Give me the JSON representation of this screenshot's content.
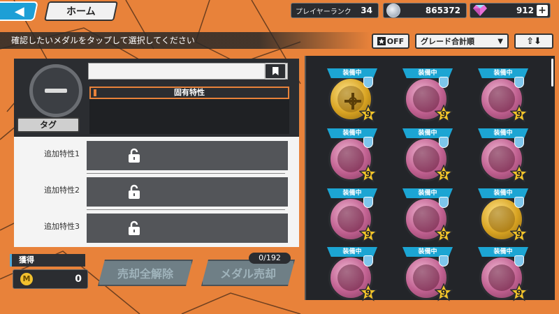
{
  "header": {
    "back_icon": "chevron-left-icon",
    "home_label": "ホーム",
    "player_rank_label": "プレイヤーランク",
    "player_rank_value": "34",
    "coins_value": "865372",
    "gems_value": "912",
    "gem_plus_label": "+"
  },
  "toolbar": {
    "instruction": "確認したいメダルをタップして選択してください",
    "filter_off_label": "OFF",
    "sort_label": "グレード合計順",
    "order_label": "⇧⬇"
  },
  "detail": {
    "unique_trait_label": "固有特性",
    "tag_label": "タグ",
    "extra_traits": [
      "追加特性1",
      "追加特性2",
      "追加特性3"
    ]
  },
  "footer": {
    "acquire_label": "獲得",
    "acquire_value": "0",
    "m_coin_label": "M",
    "unselect_all_label": "売却全解除",
    "sell_medals_label": "メダル売却",
    "selected_count": "0/192"
  },
  "medals": [
    {
      "tag": "装備中",
      "type": "gold",
      "grade": "9"
    },
    {
      "tag": "装備中",
      "type": "pink",
      "grade": "9"
    },
    {
      "tag": "装備中",
      "type": "pink",
      "grade": "9"
    },
    {
      "tag": "装備中",
      "type": "pink",
      "grade": "9"
    },
    {
      "tag": "装備中",
      "type": "pink",
      "grade": "9"
    },
    {
      "tag": "装備中",
      "type": "pink",
      "grade": "9"
    },
    {
      "tag": "装備中",
      "type": "pink",
      "grade": "9"
    },
    {
      "tag": "装備中",
      "type": "pink",
      "grade": "9"
    },
    {
      "tag": "装備中",
      "type": "gold",
      "grade": "9"
    },
    {
      "tag": "装備中",
      "type": "pink",
      "grade": "9"
    },
    {
      "tag": "装備中",
      "type": "pink",
      "grade": "9"
    },
    {
      "tag": "装備中",
      "type": "pink",
      "grade": "9"
    }
  ],
  "colors": {
    "background": "#e8823a",
    "accent_blue": "#1ca5d3",
    "panel_dark": "#232529"
  }
}
